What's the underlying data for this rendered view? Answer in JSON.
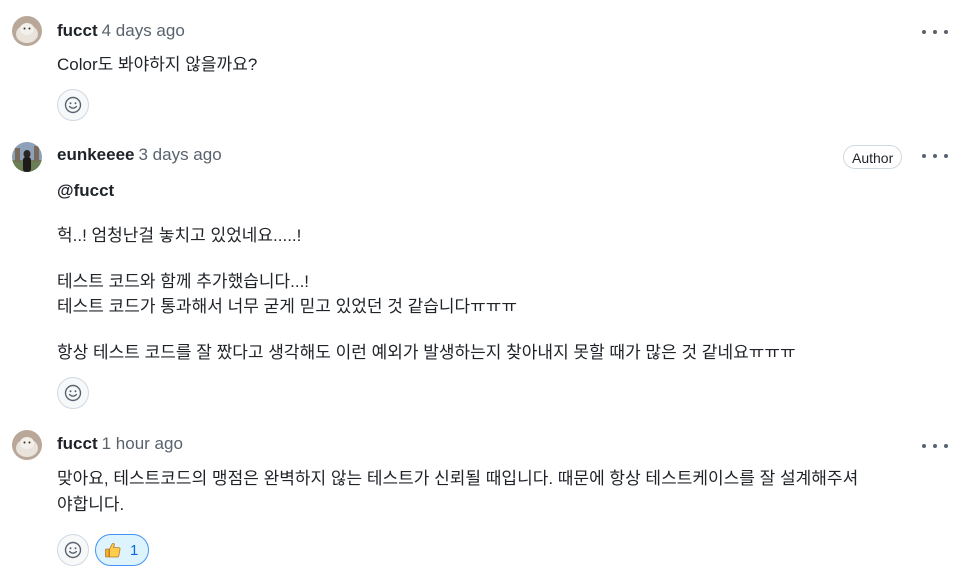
{
  "comments": [
    {
      "author": "fucct",
      "time": "4 days ago",
      "avatar": "cat-avatar",
      "lines": [
        "Color도 봐야하지 않을까요?"
      ]
    },
    {
      "author": "eunkeeee",
      "time": "3 days ago",
      "avatar": "person-avatar",
      "badge": "Author",
      "lines": [
        "@fucct",
        "헉..! 엄청난걸 놓치고 있었네요.....!",
        "테스트 코드와 함께 추가했습니다...!",
        "테스트 코드가 통과해서 너무 굳게 믿고 있었던 것 같습니다ㅠㅠㅠ",
        "항상 테스트 코드를 잘 짰다고 생각해도 이런 예외가 발생하는지 찾아내지 못할 때가 많은 것 같네요ㅠㅠㅠ"
      ]
    },
    {
      "author": "fucct",
      "time": "1 hour ago",
      "avatar": "cat-avatar",
      "lines": [
        "맞아요, 테스트코드의 맹점은 완벽하지 않는 테스트가 신뢰될 때입니다. 때문에 항상 테스트케이스를 잘 설계해주셔",
        "야합니다."
      ],
      "reaction": {
        "icon": "thumbs-up-icon",
        "count": "1"
      }
    }
  ],
  "icons": {
    "add_reaction": "smiley-icon",
    "menu": "kebab-horizontal-icon"
  },
  "colors": {
    "accent": "#0969da",
    "muted": "#59636e",
    "border": "#d1d9e0",
    "reaction_bg": "#ddf4ff"
  }
}
